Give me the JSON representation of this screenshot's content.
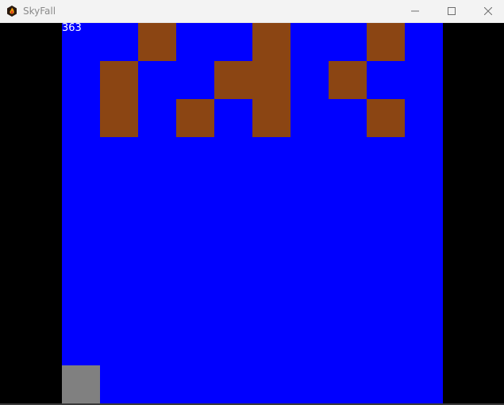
{
  "window": {
    "title": "SkyFall",
    "app_icon": "skyfall-flame-icon",
    "controls": {
      "minimize_icon": "minimize-icon",
      "maximize_icon": "maximize-icon",
      "close_icon": "close-icon"
    }
  },
  "game": {
    "score": "363",
    "colors": {
      "background": "#0000ff",
      "letterbox": "#000000",
      "block": "#8b4513",
      "player": "#808080",
      "score_text": "#ffffff"
    },
    "grid": {
      "columns": 10,
      "rows": 10
    },
    "blocks": [
      {
        "col": 2,
        "row": 0
      },
      {
        "col": 5,
        "row": 0
      },
      {
        "col": 8,
        "row": 0
      },
      {
        "col": 1,
        "row": 1
      },
      {
        "col": 4,
        "row": 1
      },
      {
        "col": 5,
        "row": 1
      },
      {
        "col": 7,
        "row": 1
      },
      {
        "col": 1,
        "row": 2
      },
      {
        "col": 3,
        "row": 2
      },
      {
        "col": 5,
        "row": 2
      },
      {
        "col": 8,
        "row": 2
      }
    ],
    "player": {
      "col": 0,
      "row": 9
    }
  }
}
